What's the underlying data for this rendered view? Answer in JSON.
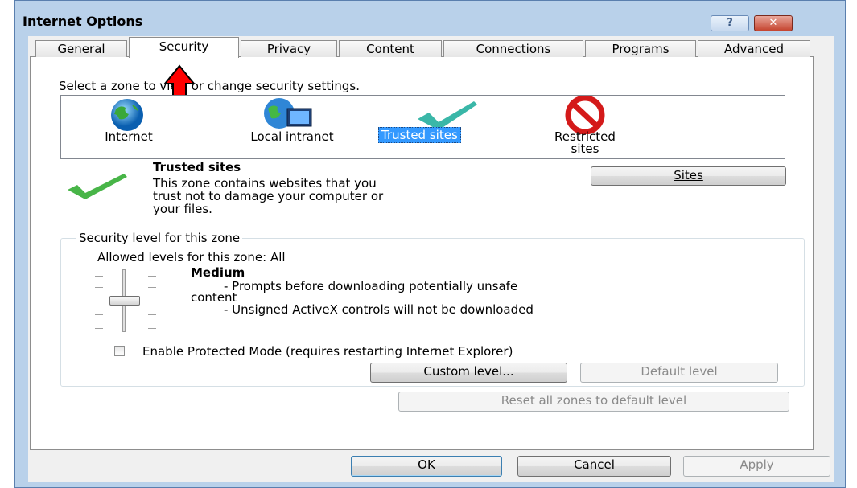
{
  "window": {
    "title": "Internet Options"
  },
  "caption_buttons": {
    "help": "?",
    "close": "✕"
  },
  "tabs": [
    {
      "label": "General",
      "active": false
    },
    {
      "label": "Security",
      "active": true
    },
    {
      "label": "Privacy",
      "active": false
    },
    {
      "label": "Content",
      "active": false
    },
    {
      "label": "Connections",
      "active": false
    },
    {
      "label": "Programs",
      "active": false
    },
    {
      "label": "Advanced",
      "active": false
    }
  ],
  "security": {
    "instruction": "Select a zone to view or change security settings.",
    "zones": [
      {
        "label": "Internet",
        "icon": "globe-icon"
      },
      {
        "label": "Local intranet",
        "icon": "intranet-globe-icon"
      },
      {
        "label": "Trusted sites",
        "icon": "checkmark-icon",
        "selected": true
      },
      {
        "label_line1": "Restricted",
        "label_line2": "sites",
        "icon": "restricted-icon"
      }
    ],
    "zone_detail": {
      "title": "Trusted sites",
      "description_lines": [
        "This zone contains websites that you",
        "trust not to damage your computer or",
        "your files."
      ],
      "sites_button": "Sites"
    },
    "level_group": {
      "legend": "Security level for this zone",
      "allowed": "Allowed levels for this zone: All",
      "level_name": "Medium",
      "level_lines": [
        "- Prompts before downloading potentially unsafe",
        "content",
        "- Unsigned ActiveX controls will not be downloaded"
      ],
      "protected_mode_label": "Enable Protected Mode (requires restarting Internet Explorer)",
      "protected_mode_checked": false,
      "custom_level_button": "Custom level...",
      "default_level_button": "Default level"
    },
    "reset_all_button": "Reset all zones to default level"
  },
  "footer": {
    "ok": "OK",
    "cancel": "Cancel",
    "apply": "Apply"
  },
  "annotation": {
    "icon": "red-up-arrow-icon",
    "color": "#ff0000"
  }
}
